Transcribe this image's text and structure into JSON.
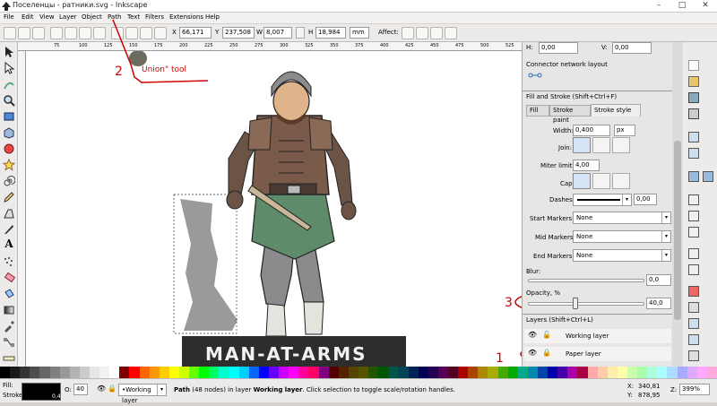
{
  "window": {
    "title": "Поселенцы - ратники.svg - Inkscape",
    "controls": [
      "–",
      "□",
      "✕"
    ]
  },
  "menu": [
    "File",
    "Edit",
    "View",
    "Layer",
    "Object",
    "Path",
    "Text",
    "Filters",
    "Extensions",
    "Help"
  ],
  "tool_controls": {
    "x_label": "X",
    "x_value": "66,171",
    "y_label": "Y",
    "y_value": "237,508",
    "w_label": "W",
    "w_value": "8,007",
    "h_label": "H",
    "h_value": "18,984",
    "unit": "mm",
    "affect_label": "Affect:"
  },
  "ruler_marks": [
    "75",
    "100",
    "125",
    "150",
    "175",
    "200",
    "225",
    "250",
    "275",
    "300",
    "325",
    "350",
    "375",
    "400",
    "425",
    "450",
    "475",
    "500",
    "525"
  ],
  "canvas": {
    "banner_text": "MAN-AT-ARMS"
  },
  "annotations": {
    "n1": "1",
    "n2": "2",
    "n3": "3",
    "union_label": "Union\" tool"
  },
  "dock": {
    "h_label": "H:",
    "h_value": "0,00",
    "v_label": "V:",
    "v_value": "0,00",
    "connector_title": "Connector network layout",
    "fill_stroke_title": "Fill and Stroke (Shift+Ctrl+F)",
    "tabs": [
      "Fill",
      "Stroke paint",
      "Stroke style"
    ],
    "width_label": "Width:",
    "width_value": "0,400",
    "width_unit": "px",
    "join_label": "Join:",
    "miter_label": "Miter limit:",
    "miter_value": "4,00",
    "cap_label": "Cap:",
    "dashes_label": "Dashes:",
    "dashes_value": "0,00",
    "start_markers_label": "Start Markers:",
    "start_markers_value": "None",
    "mid_markers_label": "Mid Markers:",
    "mid_markers_value": "None",
    "end_markers_label": "End Markers:",
    "end_markers_value": "None",
    "blur_label": "Blur:",
    "blur_value": "0,0",
    "opacity_label": "Opacity, %",
    "opacity_value": "40,0",
    "opacity_level": 0.4,
    "layers_title": "Layers (Shift+Ctrl+L)",
    "layers": [
      "Working layer",
      "Paper layer"
    ]
  },
  "status": {
    "fill_label": "Fill:",
    "stroke_label": "Stroke:",
    "stroke_value": "0,4",
    "opacity_short": "O:",
    "opacity_short_value": "40",
    "layer_select": "•Working layer",
    "message_bold": "Path",
    "message_rest": " (48 nodes) in layer ",
    "message_layer": "Working layer",
    "message_tail": ". Click selection to toggle scale/rotation handles.",
    "x_label": "X:",
    "x_value": "340,81",
    "y_label": "Y:",
    "y_value": "878,95",
    "z_label": "Z:",
    "zoom_value": "399%"
  },
  "colors": {
    "annotation_red": "#d10000",
    "selection_shadow": "#9a9a9a",
    "banner_bg": "#2d2d2d"
  }
}
